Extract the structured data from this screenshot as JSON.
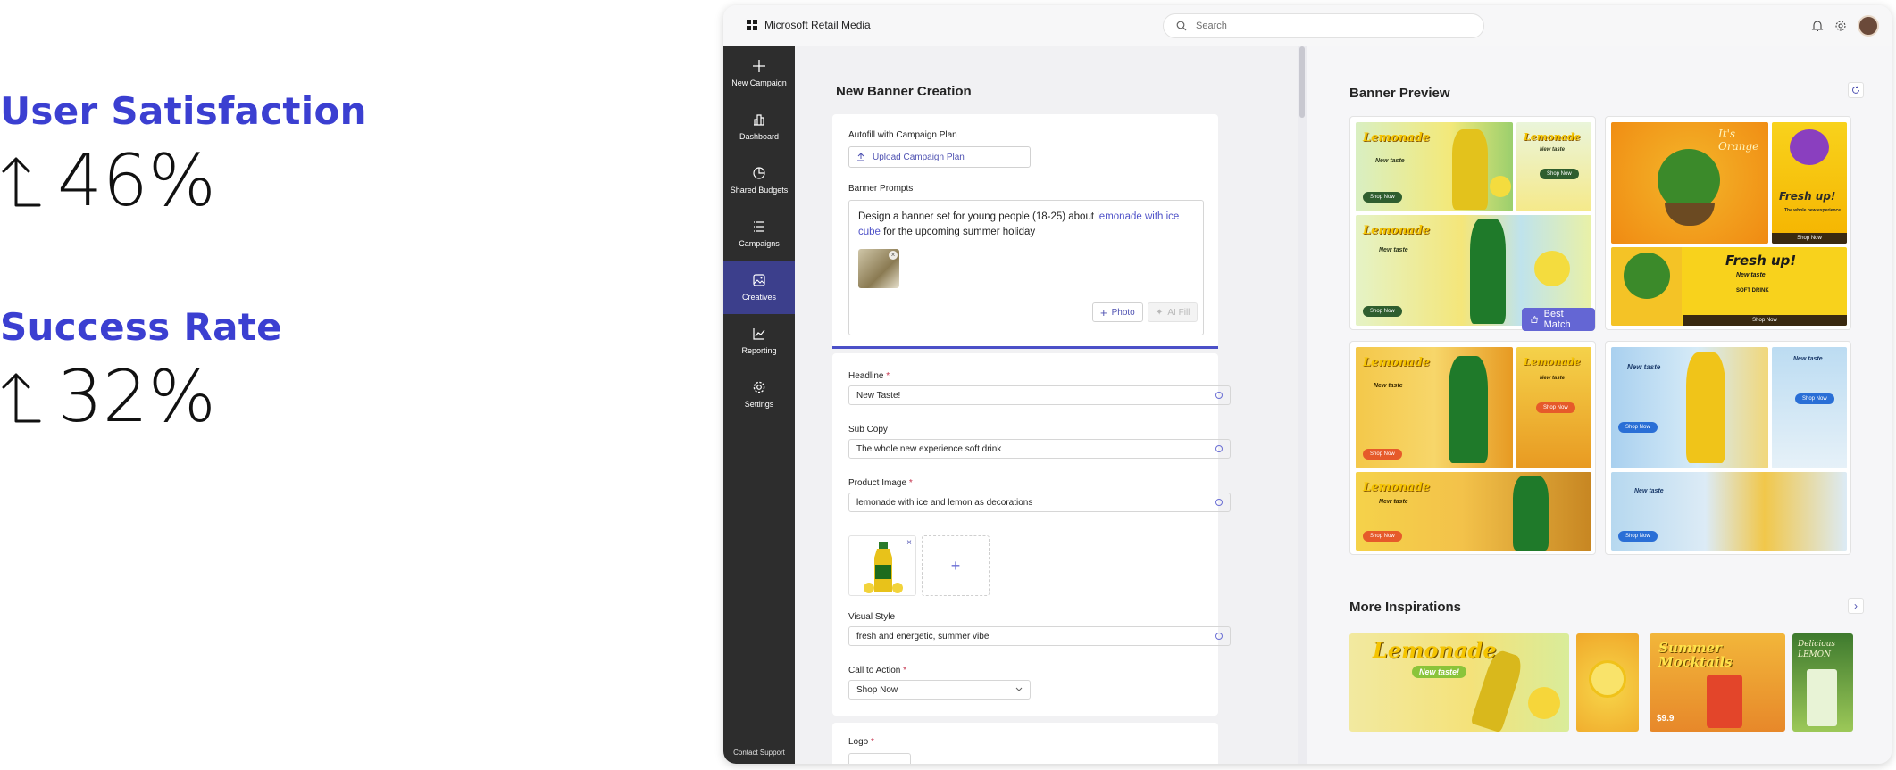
{
  "metrics": [
    {
      "title": "User Satisfaction",
      "value": "46%"
    },
    {
      "title": "Success Rate",
      "value": "32%"
    }
  ],
  "app": {
    "name": "Microsoft Retail Media",
    "search_placeholder": "Search"
  },
  "sidebar": {
    "items": [
      {
        "label": "New Campaign",
        "icon": "plus-icon"
      },
      {
        "label": "Dashboard",
        "icon": "bar-chart-icon"
      },
      {
        "label": "Shared Budgets",
        "icon": "pie-chart-icon"
      },
      {
        "label": "Campaigns",
        "icon": "list-icon"
      },
      {
        "label": "Creatives",
        "icon": "image-icon",
        "active": true
      },
      {
        "label": "Reporting",
        "icon": "line-chart-icon"
      },
      {
        "label": "Settings",
        "icon": "gear-icon"
      }
    ],
    "support": "Contact Support"
  },
  "form": {
    "title": "New Banner Creation",
    "autofill_label": "Autofill with Campaign Plan",
    "upload_label": "Upload Campaign Plan",
    "prompts_label": "Banner Prompts",
    "prompt_text_1": "Design a banner set for young people (18-25) about ",
    "prompt_highlight": "lemonade with ice cube",
    "prompt_text_2": " for the upcoming summer holiday",
    "photo_button": "Photo",
    "aifill_button": "AI Fill",
    "headline_label": "Headline",
    "headline_value": "New Taste!",
    "subcopy_label": "Sub Copy",
    "subcopy_value": "The whole new experience soft drink",
    "product_image_label": "Product Image",
    "product_image_value": "lemonade with ice and lemon as decorations",
    "visual_style_label": "Visual Style",
    "visual_style_value": "fresh and energetic, summer vibe",
    "cta_label": "Call to Action",
    "cta_value": "Shop Now",
    "logo_label": "Logo"
  },
  "preview": {
    "title": "Banner Preview",
    "best_match": "Best Match",
    "more_title": "More Inspirations",
    "banner_text": {
      "lemonade": "Lemonade",
      "new_taste": "New taste",
      "shop_now": "Shop Now",
      "fresh_up": "Fresh up!",
      "its_orange": "It's Orange",
      "soft_drink": "SOFT DRINK",
      "whole_new": "The whole new experience"
    },
    "inspirations": {
      "lemonade": "Lemonade",
      "new_taste": "New taste!",
      "summer": "Summer Mocktails",
      "price": "$9.9",
      "delicious": "Delicious LEMON"
    }
  },
  "colors": {
    "accent": "#3b3fd1",
    "sidebar_bg": "#2d2d2d",
    "sidebar_active": "#3c3f8c",
    "brand_button": "#6466d4"
  }
}
